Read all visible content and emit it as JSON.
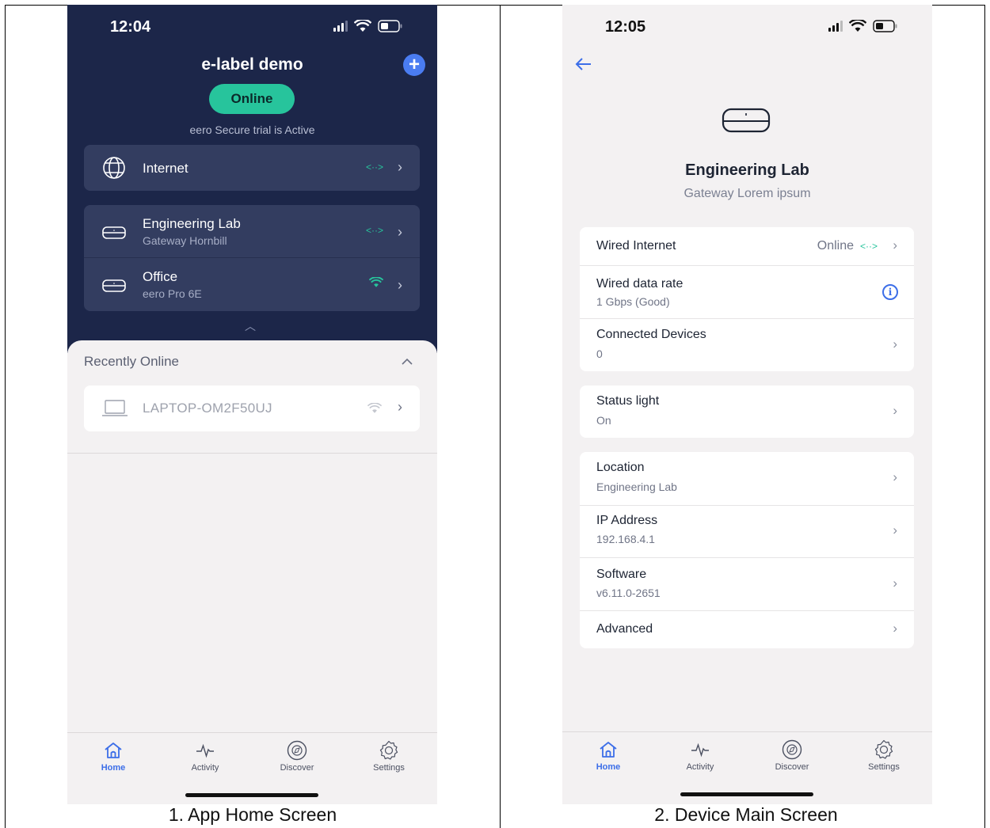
{
  "captions": {
    "left": "1. App Home Screen",
    "right": "2. Device Main Screen"
  },
  "home": {
    "status_time": "12:04",
    "title": "e-label demo",
    "status_pill": "Online",
    "trial_text": "eero Secure trial is Active",
    "internet_label": "Internet",
    "devices": [
      {
        "name": "Engineering Lab",
        "model": "Gateway Hornbill",
        "link": "wired"
      },
      {
        "name": "Office",
        "model": "eero Pro 6E",
        "link": "wifi"
      }
    ],
    "recent_title": "Recently Online",
    "recent_devices": [
      {
        "name": "LAPTOP-OM2F50UJ"
      }
    ]
  },
  "device": {
    "status_time": "12:05",
    "title": "Engineering Lab",
    "subtitle": "Gateway Lorem ipsum",
    "wired_internet_label": "Wired Internet",
    "wired_internet_status": "Online",
    "data_rate_label": "Wired data rate",
    "data_rate_value": "1 Gbps (Good)",
    "connected_label": "Connected Devices",
    "connected_value": "0",
    "status_light_label": "Status light",
    "status_light_value": "On",
    "location_label": "Location",
    "location_value": "Engineering Lab",
    "ip_label": "IP Address",
    "ip_value": "192.168.4.1",
    "software_label": "Software",
    "software_value": "v6.11.0-2651",
    "advanced_label": "Advanced"
  },
  "tabs": [
    {
      "label": "Home",
      "icon": "home-icon",
      "active": true
    },
    {
      "label": "Activity",
      "icon": "activity-icon",
      "active": false
    },
    {
      "label": "Discover",
      "icon": "compass-icon",
      "active": false
    },
    {
      "label": "Settings",
      "icon": "gear-icon",
      "active": false
    }
  ],
  "colors": {
    "header_bg": "#1c2649",
    "card_dark": "#333d60",
    "accent_green": "#27c49c",
    "accent_blue": "#3c6ee8"
  }
}
